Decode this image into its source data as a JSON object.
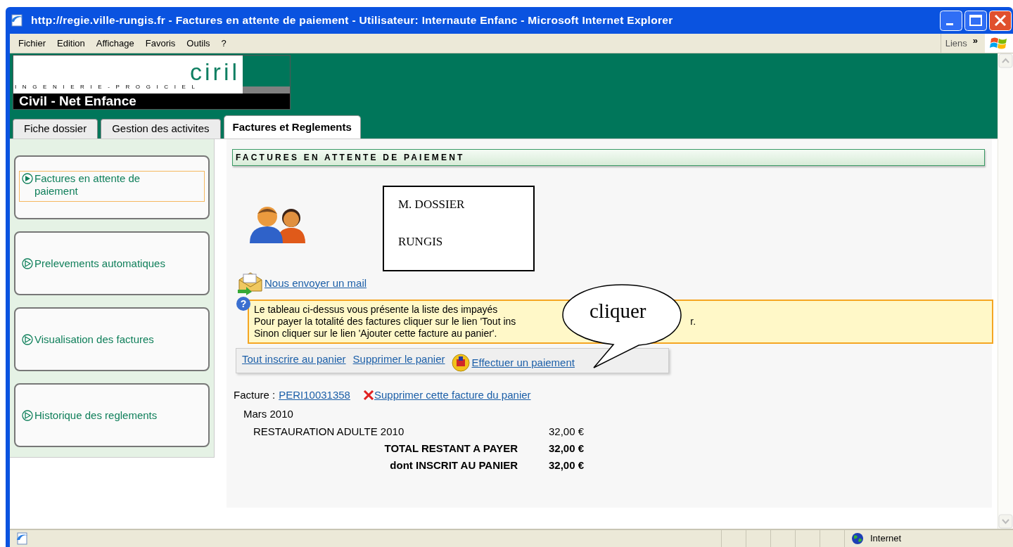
{
  "window": {
    "title": "http://regie.ville-rungis.fr - Factures en attente de paiement - Utilisateur: Internaute Enfanc - Microsoft Internet Explorer"
  },
  "menu": [
    "Fichier",
    "Edition",
    "Affichage",
    "Favoris",
    "Outils",
    "?"
  ],
  "links_bar": {
    "label": "Liens",
    "chevron": "»"
  },
  "header": {
    "brand": "ciril",
    "tagline": "INGENIERIE-PROGICIEL",
    "app_name": "Civil - Net Enfance"
  },
  "tabs": [
    {
      "label": "Fiche dossier",
      "selected": false
    },
    {
      "label": "Gestion des activites",
      "selected": false
    },
    {
      "label": "Factures et Reglements",
      "selected": true
    }
  ],
  "sidebar": {
    "items": [
      {
        "label": "Factures en attente de paiement",
        "selected": true
      },
      {
        "label": "Prelevements automatiques",
        "selected": false
      },
      {
        "label": "Visualisation des factures",
        "selected": false
      },
      {
        "label": "Historique des reglements",
        "selected": false
      }
    ]
  },
  "section_title": "FACTURES EN ATTENTE DE PAIEMENT",
  "contact_box": {
    "lines": [
      "M. DOSSIER",
      "RUNGIS"
    ]
  },
  "mail_link": "Nous envoyer un mail",
  "help_icon": "?",
  "info": {
    "lines": [
      [
        "Le tableau ci-dessus vous présente la liste des impayés"
      ],
      [
        "Pour payer la totalité des factures cliquer sur le lien 'Tout ins",
        "r."
      ],
      [
        "Sinon cliquer sur le lien 'Ajouter cette facture au panier'."
      ]
    ]
  },
  "callout": "cliquer",
  "actions": [
    {
      "label": "Tout inscrire au panier",
      "kind": "link"
    },
    {
      "label": "Supprimer le panier",
      "kind": "link"
    },
    {
      "label": "Effectuer un paiement",
      "kind": "payment"
    }
  ],
  "invoice": {
    "label": "Facture :",
    "number": "PERI10031358",
    "remove_link": "Supprimer cette facture du panier",
    "period": "Mars 2010",
    "lines": [
      {
        "label": "RESTAURATION ADULTE 2010",
        "amount": "32,00 €",
        "kind": "item"
      },
      {
        "label": "TOTAL RESTANT A PAYER",
        "amount": "32,00 €",
        "kind": "total"
      },
      {
        "label": "dont INSCRIT AU PANIER",
        "amount": "32,00 €",
        "kind": "total"
      }
    ]
  },
  "status_bar": {
    "zone": "Internet"
  }
}
